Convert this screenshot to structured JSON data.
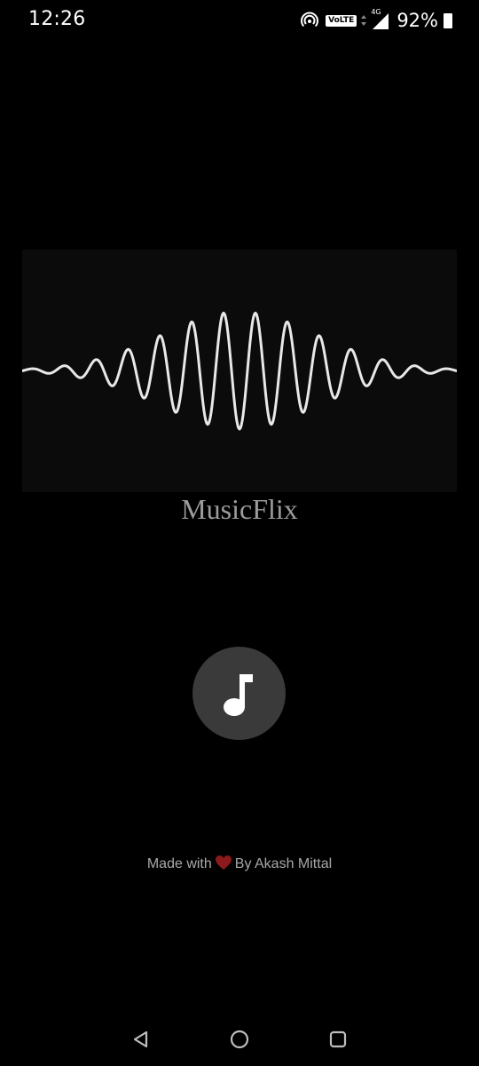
{
  "status_bar": {
    "time": "12:26",
    "volte": "VoLTE",
    "network": "4G",
    "battery": "92%"
  },
  "app": {
    "title": "MusicFlix",
    "banner_icon": "sound-waveform"
  },
  "main": {
    "play_icon": "music-note-icon"
  },
  "footer": {
    "made_with": "Made with",
    "author": "By Akash Mittal"
  },
  "nav": {
    "back": "back-triangle-icon",
    "home": "home-circle-icon",
    "recents": "recents-square-icon"
  },
  "colors": {
    "background": "#000000",
    "banner": "#0b0b0b",
    "title": "#9c9c9c",
    "button": "#3a3a3a",
    "heart": "#8b1a1a",
    "credit": "#a8a8a8"
  }
}
